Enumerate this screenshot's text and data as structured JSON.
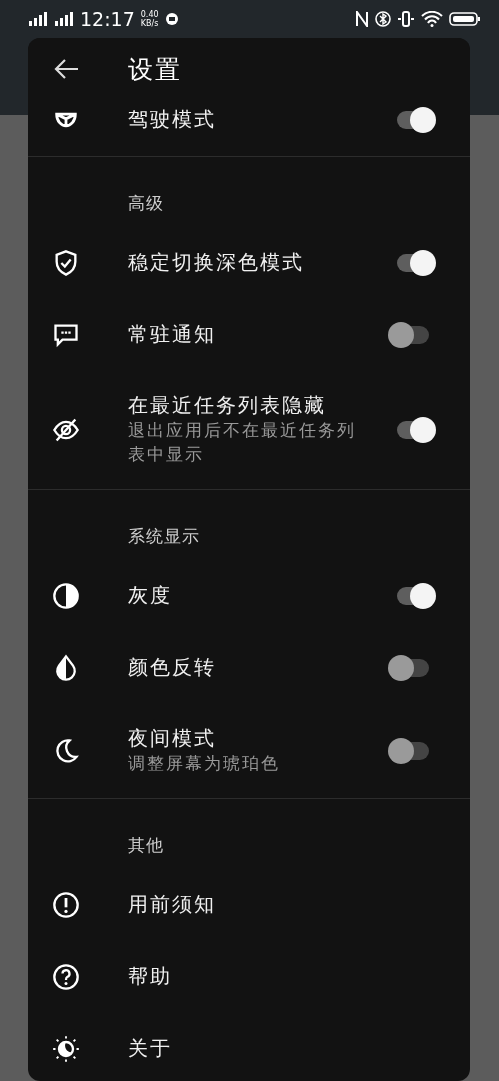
{
  "status_bar": {
    "time": "12:17",
    "net_speed": "0.40",
    "net_unit": "KB/s"
  },
  "header": {
    "title": "设置"
  },
  "sections": [
    {
      "items": [
        {
          "kind": "toggle",
          "title": "驾驶模式",
          "on": true
        }
      ]
    },
    {
      "heading": "高级",
      "items": [
        {
          "kind": "toggle",
          "title": "稳定切换深色模式",
          "on": true
        },
        {
          "kind": "toggle",
          "title": "常驻通知",
          "on": false
        },
        {
          "kind": "toggle",
          "title": "在最近任务列表隐藏",
          "subtitle": "退出应用后不在最近任务列表中显示",
          "on": true
        }
      ]
    },
    {
      "heading": "系统显示",
      "items": [
        {
          "kind": "toggle",
          "title": "灰度",
          "on": true
        },
        {
          "kind": "toggle",
          "title": "颜色反转",
          "on": false
        },
        {
          "kind": "toggle",
          "title": "夜间模式",
          "subtitle": "调整屏幕为琥珀色",
          "on": false
        }
      ]
    },
    {
      "heading": "其他",
      "items": [
        {
          "kind": "link",
          "title": "用前须知"
        },
        {
          "kind": "link",
          "title": "帮助"
        },
        {
          "kind": "link",
          "title": "关于"
        }
      ]
    }
  ]
}
